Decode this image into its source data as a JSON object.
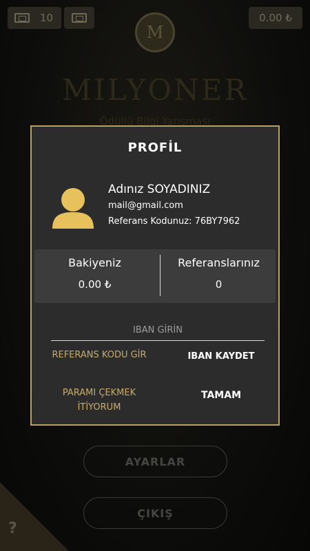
{
  "top_bar": {
    "ticket_count": "10",
    "balance": "0.00 ₺"
  },
  "logo": {
    "letter": "M",
    "title": "MILYONER",
    "subtitle": "Ödüllü Bilgi Yarışması"
  },
  "menu": {
    "settings_label": "AYARLAR",
    "exit_label": "ÇIKIŞ",
    "help_label": "?"
  },
  "profile_modal": {
    "title": "PROFİL",
    "user_name": "Adınız SOYADINIZ",
    "user_email": "mail@gmail.com",
    "referral_code": "Referans Kodunuz: 76BY7962",
    "balance_label": "Bakiyeniz",
    "balance_value": "0.00 ₺",
    "referrals_label": "Referanslarınız",
    "referrals_value": "0",
    "iban_placeholder": "IBAN GİRİN",
    "enter_ref_code_label": "REFERANS KODU GİR",
    "save_iban_label": "IBAN KAYDET",
    "withdraw_label": "PARAMI ÇEKMEK\nİTİYORUM",
    "ok_label": "TAMAM"
  },
  "colors": {
    "accent_gold": "#c7ad6b",
    "modal_border": "#b8a067",
    "modal_bg": "#2c2c2c",
    "avatar": "#e7c25c"
  },
  "icons": [
    "ticket-icon",
    "ticket-outline-icon",
    "user-avatar-icon",
    "question-icon"
  ]
}
